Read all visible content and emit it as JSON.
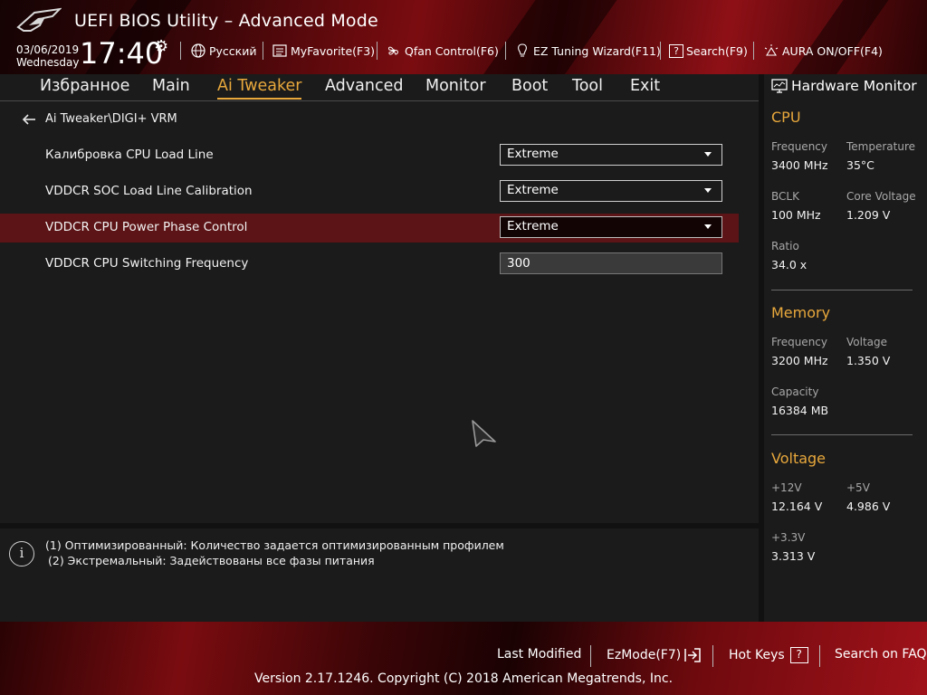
{
  "header": {
    "title": "UEFI BIOS Utility – Advanced Mode",
    "date": "03/06/2019",
    "weekday": "Wednesday",
    "time": "17:40",
    "tools": [
      {
        "label": "Русский",
        "icon": "globe-icon"
      },
      {
        "label": "MyFavorite(F3)",
        "icon": "favorite-list-icon"
      },
      {
        "label": "Qfan Control(F6)",
        "icon": "fan-icon"
      },
      {
        "label": "EZ Tuning Wizard(F11)",
        "icon": "lightbulb-icon"
      },
      {
        "label": "Search(F9)",
        "icon": "question-box-icon"
      },
      {
        "label": "AURA ON/OFF(F4)",
        "icon": "aura-light-icon"
      }
    ]
  },
  "nav": {
    "tabs": [
      "Избранное",
      "Main",
      "Ai Tweaker",
      "Advanced",
      "Monitor",
      "Boot",
      "Tool",
      "Exit"
    ],
    "active": "Ai Tweaker"
  },
  "breadcrumb": "Ai Tweaker\\DIGI+ VRM",
  "settings": [
    {
      "label": "Калибровка CPU Load Line",
      "value": "Extreme",
      "type": "dropdown"
    },
    {
      "label": "VDDCR SOC Load Line Calibration",
      "value": "Extreme",
      "type": "dropdown"
    },
    {
      "label": "VDDCR CPU Power Phase Control",
      "value": "Extreme",
      "type": "dropdown",
      "selected": true
    },
    {
      "label": "VDDCR CPU Switching Frequency",
      "value": "300",
      "type": "number"
    }
  ],
  "help": {
    "line1": "(1) Оптимизированный: Количество задается оптимизированным профилем",
    "line2": "(2) Экстремальный: Задействованы все фазы питания"
  },
  "hardware_monitor": {
    "title": "Hardware Monitor",
    "cpu": {
      "heading": "CPU",
      "frequency_label": "Frequency",
      "frequency": "3400 MHz",
      "temperature_label": "Temperature",
      "temperature": "35°C",
      "bclk_label": "BCLK",
      "bclk": "100 MHz",
      "core_voltage_label": "Core Voltage",
      "core_voltage": "1.209 V",
      "ratio_label": "Ratio",
      "ratio": "34.0 x"
    },
    "memory": {
      "heading": "Memory",
      "frequency_label": "Frequency",
      "frequency": "3200 MHz",
      "voltage_label": "Voltage",
      "voltage": "1.350 V",
      "capacity_label": "Capacity",
      "capacity": "16384 MB"
    },
    "voltage": {
      "heading": "Voltage",
      "v12_label": "+12V",
      "v12": "12.164 V",
      "v5_label": "+5V",
      "v5": "4.986 V",
      "v33_label": "+3.3V",
      "v33": "3.313 V"
    }
  },
  "footer": {
    "last_modified": "Last Modified",
    "ezmode": "EzMode(F7)",
    "hot_keys": "Hot Keys",
    "hot_keys_glyph": "?",
    "search_faq": "Search on FAQ",
    "copyright": "Version 2.17.1246. Copyright (C) 2018 American Megatrends, Inc."
  },
  "colors": {
    "accent": "#e8a83c",
    "selected_row": "#5c1416",
    "panel_bg": "#1b1b1b"
  }
}
